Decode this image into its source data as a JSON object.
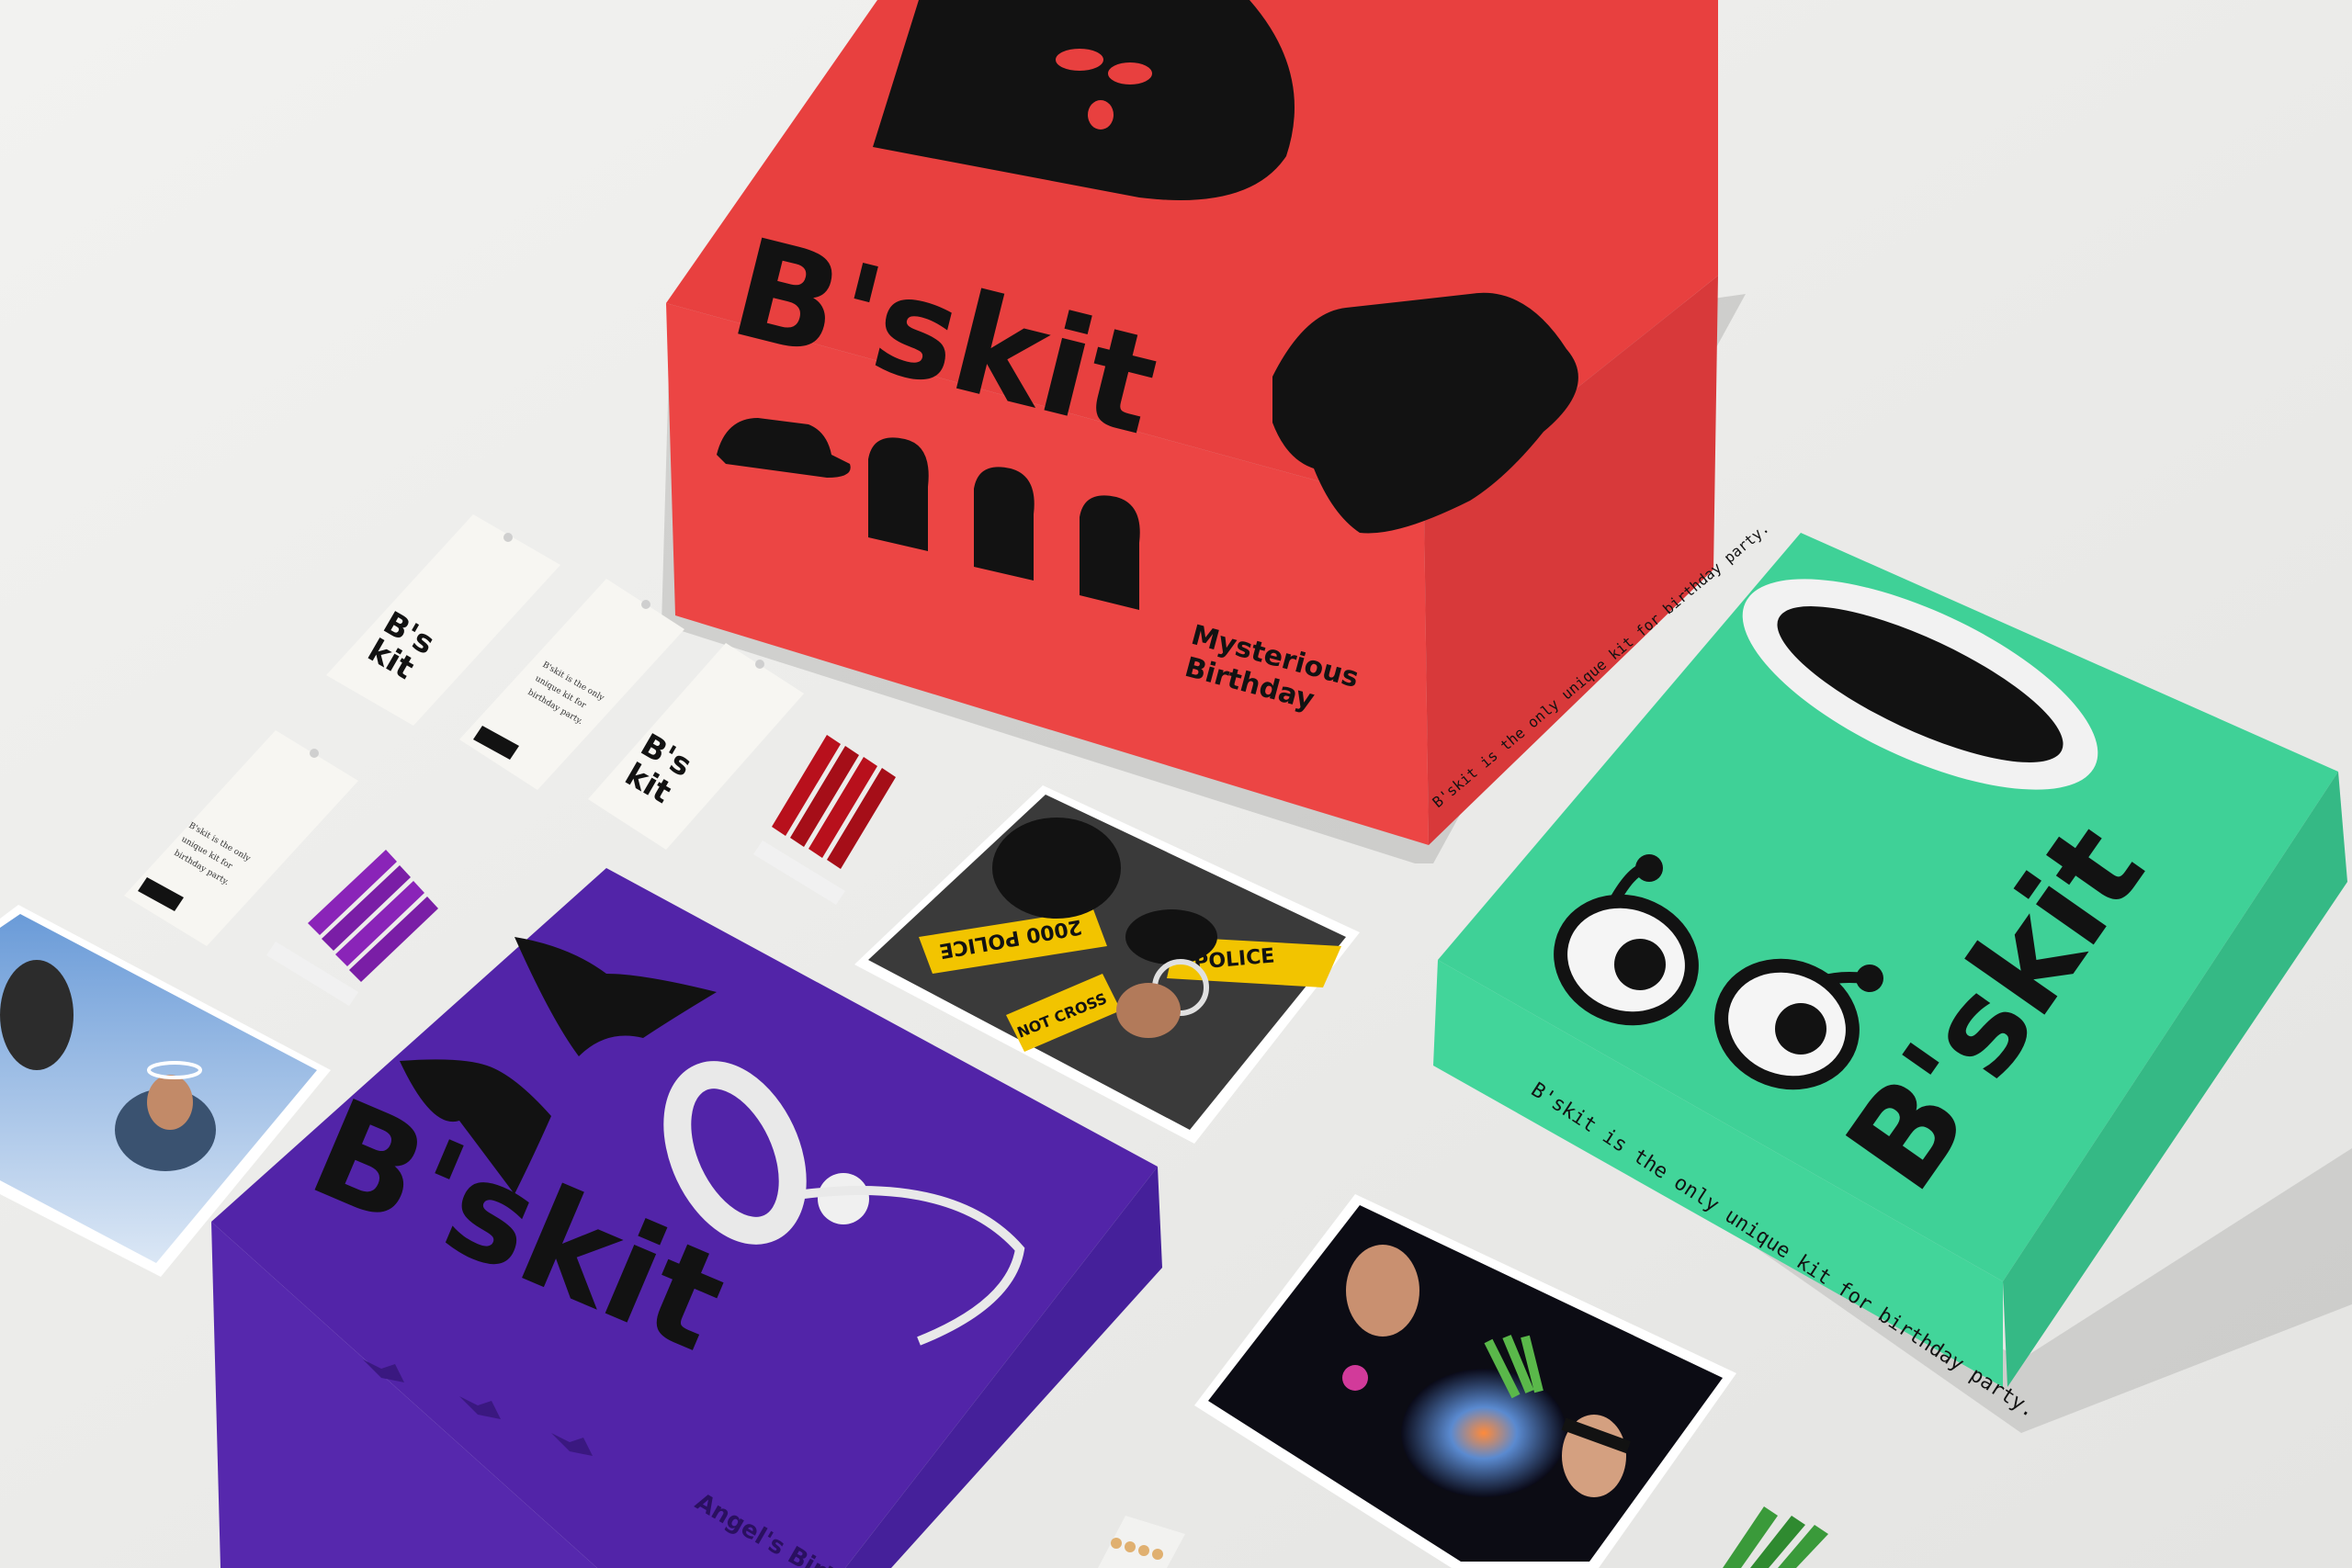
{
  "scene": {
    "background": "#ececea",
    "colors": {
      "red_box": "#e8403f",
      "purple_box": "#5224a8",
      "green_box": "#3fd197",
      "ink": "#121212",
      "tag": "#f7f6f2",
      "red_candle": "#b8101c",
      "purple_candle": "#8a24b8",
      "green_candle": "#3a9a3a"
    }
  },
  "red_box": {
    "logo": "B'skit",
    "subtitle_line1": "Mysterious",
    "subtitle_line2": "Birthday",
    "side_text": "B'skit is the only unique kit for birthday party."
  },
  "green_box": {
    "logo": "B'skit",
    "tagline": "B'skit is the only unique kit for birthday party."
  },
  "purple_box": {
    "logo": "B'skit",
    "side_text": "Angel's Birthday"
  },
  "tags": {
    "logo_line1": "B's",
    "logo_line2": "kit",
    "text_line1": "B'skit is the only",
    "text_line2": "unique kit for",
    "text_line3": "birthday party."
  },
  "photos": {
    "police_tape_1": "2000 POLICE",
    "police_tape_2": "NOT CROSS",
    "police_tape_3": "POLICE"
  }
}
